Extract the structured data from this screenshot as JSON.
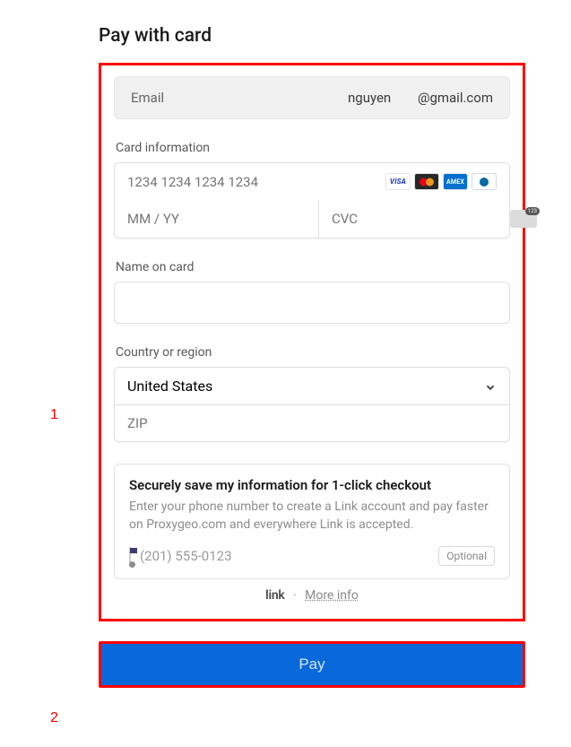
{
  "title": "Pay with card",
  "email": {
    "label": "Email",
    "middle": "nguyen",
    "domain": "@gmail.com"
  },
  "card": {
    "section_label": "Card information",
    "number_placeholder": "1234 1234 1234 1234",
    "exp_placeholder": "MM / YY",
    "cvc_placeholder": "CVC"
  },
  "name": {
    "section_label": "Name on card",
    "value": ""
  },
  "country": {
    "section_label": "Country or region",
    "selected": "United States",
    "zip_placeholder": "ZIP"
  },
  "link": {
    "title": "Securely save my information for 1-click checkout",
    "desc": "Enter your phone number to create a Link account and pay faster on Proxygeo.com and everywhere Link is accepted.",
    "phone_placeholder": "(201) 555-0123",
    "optional_label": "Optional",
    "logo": "link",
    "dot": "·",
    "more": "More info"
  },
  "pay_label": "Pay",
  "annotations": {
    "one": "1",
    "two": "2"
  }
}
